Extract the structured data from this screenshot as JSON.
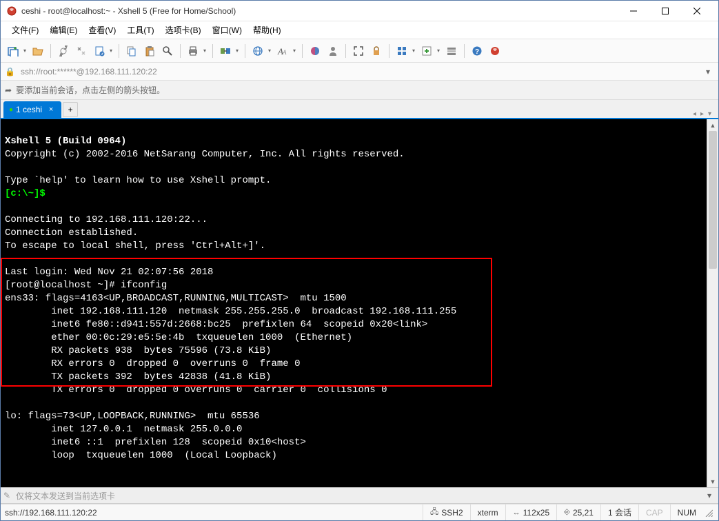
{
  "window": {
    "title": "ceshi - root@localhost:~ - Xshell 5 (Free for Home/School)"
  },
  "menu": {
    "file": "文件(F)",
    "edit": "编辑(E)",
    "view": "查看(V)",
    "tools": "工具(T)",
    "tabs": "选项卡(B)",
    "window": "窗口(W)",
    "help": "帮助(H)"
  },
  "address": {
    "text": "ssh://root:******@192.168.111.120:22"
  },
  "hint": {
    "text": "要添加当前会话，点击左侧的箭头按钮。"
  },
  "tab": {
    "name": "1 ceshi"
  },
  "inputline": {
    "placeholder": "仅将文本发送到当前选项卡"
  },
  "terminal": {
    "line1": "Xshell 5 (Build 0964)",
    "line2": "Copyright (c) 2002-2016 NetSarang Computer, Inc. All rights reserved.",
    "line3": "",
    "line4": "Type `help' to learn how to use Xshell prompt.",
    "prompt1": "[c:\\~]$",
    "line5": "",
    "line6": "Connecting to 192.168.111.120:22...",
    "line7": "Connection established.",
    "line8": "To escape to local shell, press 'Ctrl+Alt+]'.",
    "line9": "",
    "line10": "Last login: Wed Nov 21 02:07:56 2018",
    "line11": "[root@localhost ~]# ifconfig",
    "line12": "ens33: flags=4163<UP,BROADCAST,RUNNING,MULTICAST>  mtu 1500",
    "line13": "        inet 192.168.111.120  netmask 255.255.255.0  broadcast 192.168.111.255",
    "line14": "        inet6 fe80::d941:557d:2668:bc25  prefixlen 64  scopeid 0x20<link>",
    "line15": "        ether 00:0c:29:e5:5e:4b  txqueuelen 1000  (Ethernet)",
    "line16": "        RX packets 938  bytes 75596 (73.8 KiB)",
    "line17": "        RX errors 0  dropped 0  overruns 0  frame 0",
    "line18": "        TX packets 392  bytes 42838 (41.8 KiB)",
    "line19": "        TX errors 0  dropped 0 overruns 0  carrier 0  collisions 0",
    "line20": "",
    "line21": "lo: flags=73<UP,LOOPBACK,RUNNING>  mtu 65536",
    "line22": "        inet 127.0.0.1  netmask 255.0.0.0",
    "line23": "        inet6 ::1  prefixlen 128  scopeid 0x10<host>",
    "line24": "        loop  txqueuelen 1000  (Local Loopback)"
  },
  "status": {
    "left": "ssh://192.168.111.120:22",
    "ssh": "SSH2",
    "term": "xterm",
    "size": "112x25",
    "pos": "25,21",
    "sessions": "1 会话",
    "cap": "CAP",
    "num": "NUM"
  }
}
